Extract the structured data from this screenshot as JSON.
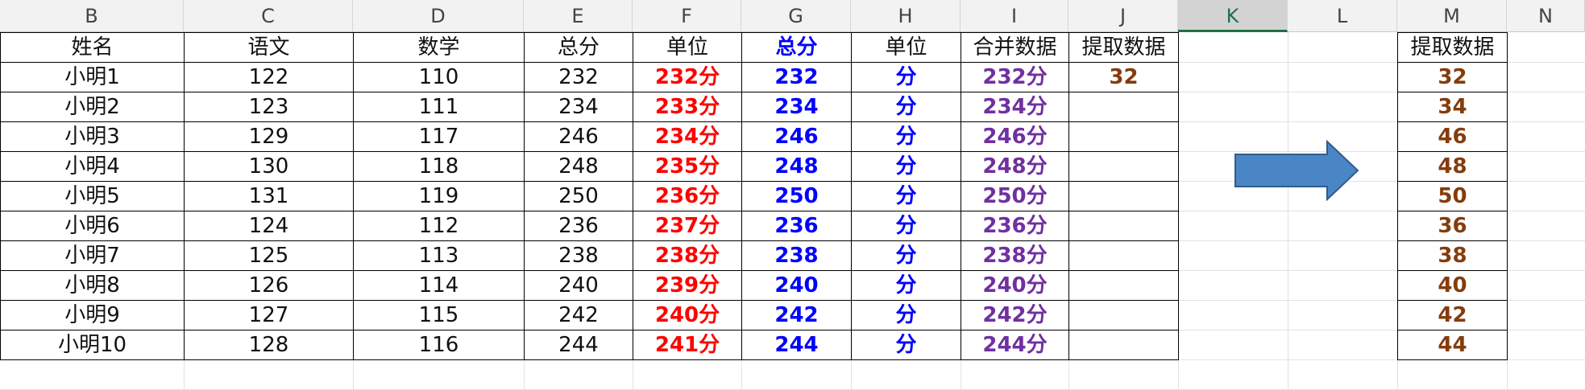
{
  "column_headers": [
    "B",
    "C",
    "D",
    "E",
    "F",
    "G",
    "H",
    "I",
    "J",
    "K",
    "L",
    "M",
    "N"
  ],
  "active_column": "K",
  "table1": {
    "headers": [
      "姓名",
      "语文",
      "数学",
      "总分",
      "单位",
      "总分",
      "单位",
      "合并数据",
      "提取数据"
    ],
    "rows": [
      [
        "小明1",
        "122",
        "110",
        "232",
        "232分",
        "232",
        "分",
        "232分",
        "32"
      ],
      [
        "小明2",
        "123",
        "111",
        "234",
        "233分",
        "234",
        "分",
        "234分",
        ""
      ],
      [
        "小明3",
        "129",
        "117",
        "246",
        "234分",
        "246",
        "分",
        "246分",
        ""
      ],
      [
        "小明4",
        "130",
        "118",
        "248",
        "235分",
        "248",
        "分",
        "248分",
        ""
      ],
      [
        "小明5",
        "131",
        "119",
        "250",
        "236分",
        "250",
        "分",
        "250分",
        ""
      ],
      [
        "小明6",
        "124",
        "112",
        "236",
        "237分",
        "236",
        "分",
        "236分",
        ""
      ],
      [
        "小明7",
        "125",
        "113",
        "238",
        "238分",
        "238",
        "分",
        "238分",
        ""
      ],
      [
        "小明8",
        "126",
        "114",
        "240",
        "239分",
        "240",
        "分",
        "240分",
        ""
      ],
      [
        "小明9",
        "127",
        "115",
        "242",
        "240分",
        "242",
        "分",
        "242分",
        ""
      ],
      [
        "小明10",
        "128",
        "116",
        "244",
        "241分",
        "244",
        "分",
        "244分",
        ""
      ]
    ]
  },
  "table2": {
    "header": "提取数据",
    "values": [
      "32",
      "34",
      "46",
      "48",
      "50",
      "36",
      "38",
      "40",
      "42",
      "44"
    ]
  },
  "colors": {
    "red": "#ff0000",
    "blue": "#0000ff",
    "purple": "#7030a0",
    "brown": "#843c0c",
    "arrow_fill": "#4a86c5",
    "arrow_stroke": "#2f5c8a",
    "active_header": "#1e7145"
  }
}
